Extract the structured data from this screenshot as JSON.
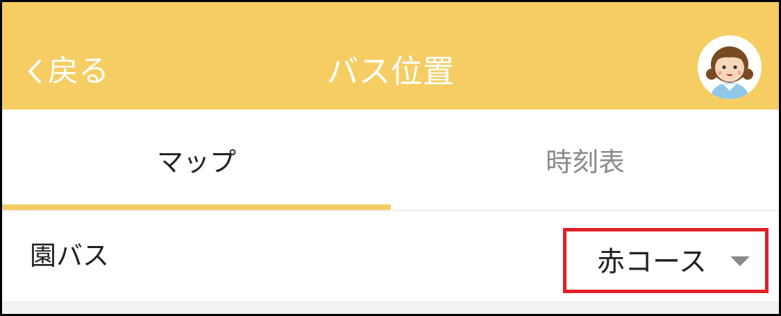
{
  "header": {
    "back_label": "戻る",
    "title": "バス位置",
    "background_color": "#f5cd63",
    "back_icon": "chevron-left-icon",
    "avatar_icon": "child-avatar-icon"
  },
  "tabs": {
    "items": [
      {
        "label": "マップ",
        "active": true
      },
      {
        "label": "時刻表",
        "active": false
      }
    ],
    "indicator_color": "#f5cd63"
  },
  "bus_row": {
    "label": "園バス",
    "selected_course": "赤コース",
    "dropdown_icon": "caret-down-icon",
    "highlight_color": "#e01f26"
  }
}
